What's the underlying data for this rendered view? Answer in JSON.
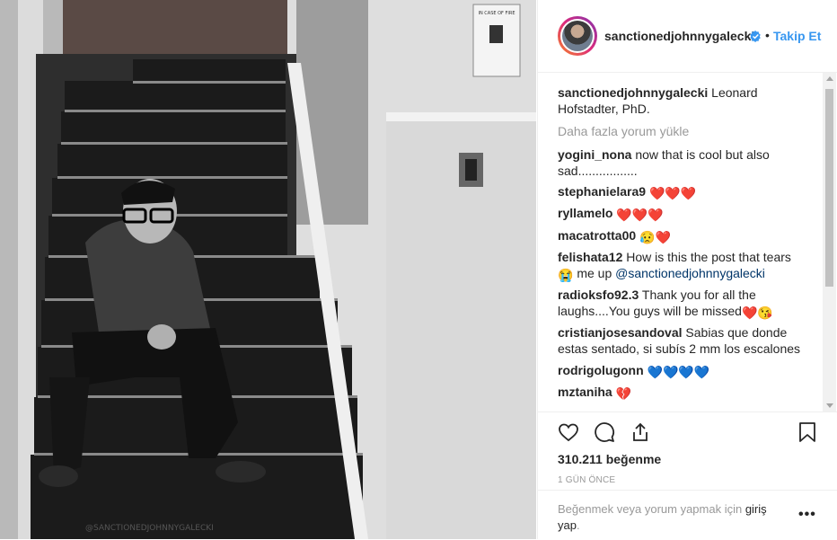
{
  "post": {
    "photo_alt": "Black and white photo of a man sitting on stairs",
    "photo_watermark": "@SANCTIONEDJOHNNYGALECKI",
    "sign_top": "IN CASE OF FIRE",
    "sign_bottom": "DO NOT USE ELEVATORS USE STAIRWAYS"
  },
  "header": {
    "username": "sanctionedjohnnygalecki",
    "dot": "•",
    "follow_label": "Takip Et"
  },
  "caption": {
    "username": "sanctionedjohnnygalecki",
    "text": " Leonard Hofstadter, PhD."
  },
  "load_more": "Daha fazla yorum yükle",
  "comments": [
    {
      "username": "yogini_nona",
      "text": " now that is cool but also sad.................",
      "emoji": ""
    },
    {
      "username": "stephanielara9",
      "text": " ",
      "emoji": "❤️❤️❤️"
    },
    {
      "username": "ryllamelo",
      "text": " ",
      "emoji": "❤️❤️❤️"
    },
    {
      "username": "macatrotta00",
      "text": " ",
      "emoji": "😥❤️"
    },
    {
      "username": "felishata12",
      "text": " How is this the post that tears ",
      "emoji": "😭",
      "after": " me up ",
      "mention": "@sanctionedjohnnygalecki"
    },
    {
      "username": "radioksfo92.3",
      "text": " Thank you for all the laughs....You guys will be missed",
      "emoji": "❤️😘"
    },
    {
      "username": "cristianjosesandoval",
      "text": " Sabias que donde estas sentado, si subís 2 mm los escalones",
      "emoji": ""
    },
    {
      "username": "rodrigolugonn",
      "text": " ",
      "emoji": "💙💙💙💙"
    },
    {
      "username": "mztaniha",
      "text": " ",
      "emoji": "💔"
    }
  ],
  "actions": {
    "likes": "310.211 beğenme",
    "time": "1 GÜN ÖNCE"
  },
  "footer": {
    "prompt": "Beğenmek veya yorum yapmak için ",
    "login_link": "giriş yap",
    "period": "."
  },
  "colors": {
    "accent": "#3897f0",
    "muted": "#999999",
    "text": "#262626"
  }
}
